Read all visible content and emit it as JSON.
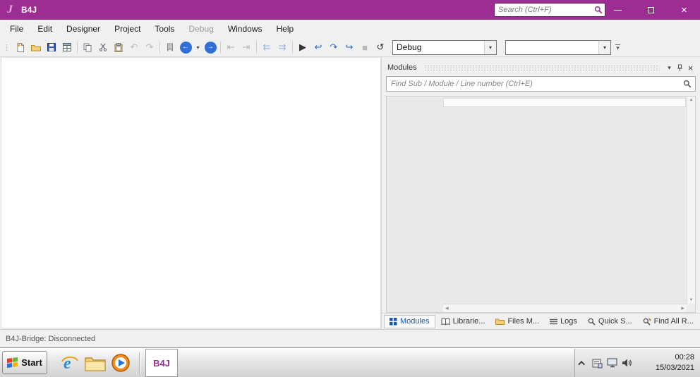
{
  "window": {
    "logo_letter": "J",
    "title": "B4J",
    "search_placeholder": "Search (Ctrl+F)"
  },
  "menubar": {
    "items": [
      {
        "label": "File",
        "enabled": true
      },
      {
        "label": "Edit",
        "enabled": true
      },
      {
        "label": "Designer",
        "enabled": true
      },
      {
        "label": "Project",
        "enabled": true
      },
      {
        "label": "Tools",
        "enabled": true
      },
      {
        "label": "Debug",
        "enabled": false
      },
      {
        "label": "Windows",
        "enabled": true
      },
      {
        "label": "Help",
        "enabled": true
      }
    ]
  },
  "toolbar": {
    "debug_combo_value": "Debug",
    "secondary_combo_value": ""
  },
  "modules_panel": {
    "title": "Modules",
    "search_placeholder": "Find Sub / Module / Line number (Ctrl+E)",
    "tabs": [
      {
        "label": "Modules",
        "selected": true
      },
      {
        "label": "Librarie...",
        "selected": false
      },
      {
        "label": "Files M...",
        "selected": false
      },
      {
        "label": "Logs",
        "selected": false
      },
      {
        "label": "Quick S...",
        "selected": false
      },
      {
        "label": "Find All R...",
        "selected": false
      }
    ]
  },
  "statusbar": {
    "text": "B4J-Bridge: Disconnected"
  },
  "taskbar": {
    "start_label": "Start",
    "task_buttons": [
      {
        "label": "B4J",
        "active": true
      }
    ],
    "clock": {
      "time": "00:28",
      "date": "15/03/2021"
    }
  },
  "icons": {
    "close_x": "×",
    "chevron_down": "▾",
    "undo": "↶",
    "redo": "↷",
    "back_arrow": "←",
    "forward_arrow": "→",
    "indent_decrease": "⇤",
    "indent_increase": "⇥",
    "comment_left": "⇇",
    "comment_right": "⇉",
    "play": "▶",
    "step_into": "↩",
    "step_over": "↷",
    "step_out": "↪",
    "stop": "■",
    "restart": "↺",
    "scroll_up": "▲",
    "scroll_down": "▼",
    "scroll_left": "◀",
    "scroll_right": "▶",
    "overflow_chevron": "▾"
  },
  "colors": {
    "titlebar_magenta": "#9b2d93",
    "brand_magenta": "#9b2d93",
    "accent_blue": "#2b6cd4",
    "selected_tab_text": "#1c57a8",
    "taskbar_gray": "#dcdcdc"
  }
}
